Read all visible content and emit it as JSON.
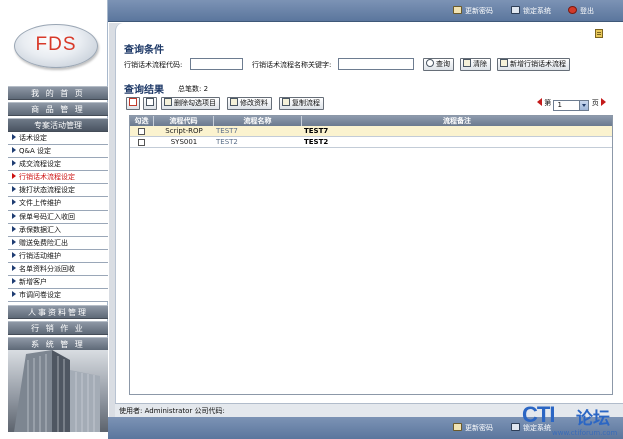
{
  "logo": {
    "text": "FDS"
  },
  "sidebar": {
    "top_menus": [
      {
        "label": "我 的 首 页"
      },
      {
        "label": "商 品 管 理"
      },
      {
        "label": "专案活动管理"
      }
    ],
    "sub_items": [
      {
        "label": "话术设定"
      },
      {
        "label": "Q&A 设定"
      },
      {
        "label": "成交流程设定"
      },
      {
        "label": "行销话术流程设定"
      },
      {
        "label": "拨打状态流程设定"
      },
      {
        "label": "文件上传维护"
      },
      {
        "label": "保单号码汇入收回"
      },
      {
        "label": "承保数据汇入"
      },
      {
        "label": "赠送免费险汇出"
      },
      {
        "label": "行销活动维护"
      },
      {
        "label": "名单资料分派回收"
      },
      {
        "label": "新增客户"
      },
      {
        "label": "市调问卷设定"
      }
    ],
    "bottom_menus": [
      {
        "label": "人事资料管理"
      },
      {
        "label": "行 销 作 业"
      },
      {
        "label": "系 统 管 理"
      }
    ]
  },
  "topbar": {
    "change_password": "更新密码",
    "lock_system": "锁定系统",
    "logout": "登出"
  },
  "query": {
    "title": "查询条件",
    "code_label": "行销话术流程代码:",
    "code_value": "",
    "keyword_label": "行销话术流程名称关键字:",
    "keyword_value": "",
    "search_button": "查询",
    "clear_button": "清除",
    "add_button": "新增行销话术流程"
  },
  "results": {
    "title": "查询结果",
    "total_label": "总笔数:",
    "total_value": "2",
    "delete_button": "删除勾选项目",
    "edit_button": "修改资料",
    "copy_button": "复制流程",
    "pager": {
      "prefix": "第",
      "page": "1",
      "suffix": "页"
    },
    "columns": [
      "勾选",
      "流程代码",
      "流程名称",
      "流程备注"
    ],
    "rows": [
      {
        "code": "Script-ROP",
        "name": "TEST7",
        "remark": "TEST7"
      },
      {
        "code": "SYS001",
        "name": "TEST2",
        "remark": "TEST2"
      }
    ]
  },
  "status": {
    "text": "使用者: Administrator 公司代码:"
  },
  "bottom_bar": {
    "change_password": "更新密码",
    "lock_system": "锁定系统"
  },
  "watermark": {
    "brand": "CTI",
    "brand_cn": "论坛",
    "url": "www.ctiforum.com"
  },
  "colors": {
    "accent": "#5b769d",
    "highlight_row": "#fbf3cf",
    "current_menu": "#cc1111"
  }
}
